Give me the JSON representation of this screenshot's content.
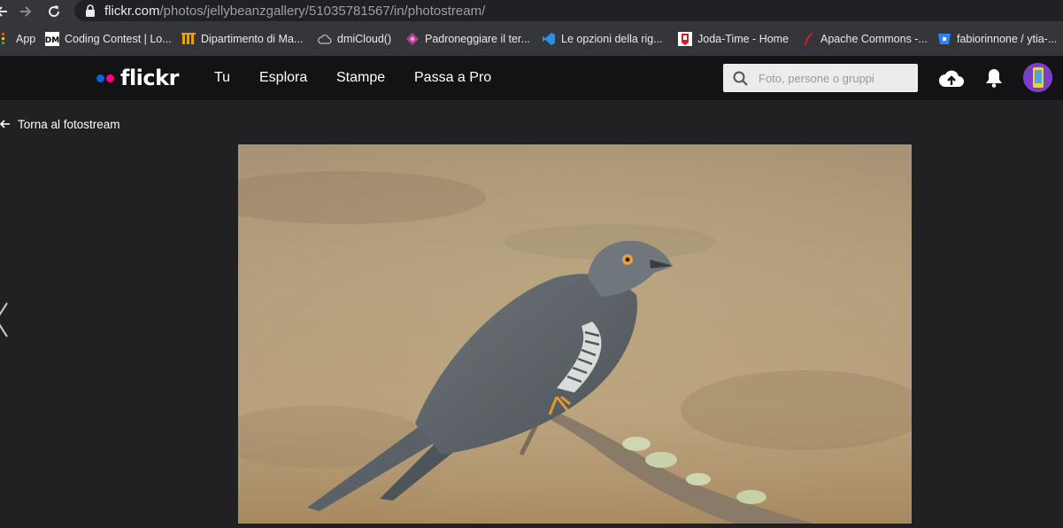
{
  "browser": {
    "url_host": "flickr.com",
    "url_path": "/photos/jellybeanzgallery/51035781567/in/photostream/",
    "bookmarks": [
      {
        "label": "App",
        "icon": "apps-grid-icon"
      },
      {
        "label": "Coding Contest | Lo...",
        "icon": "coding-contest-icon"
      },
      {
        "label": "Dipartimento di Ma...",
        "icon": "dipartimento-icon"
      },
      {
        "label": "dmiCloud()",
        "icon": "cloud-icon"
      },
      {
        "label": "Padroneggiare il ter...",
        "icon": "terminal-icon"
      },
      {
        "label": "Le opzioni della rig...",
        "icon": "vscode-icon"
      },
      {
        "label": "Joda-Time - Home",
        "icon": "joda-icon"
      },
      {
        "label": "Apache Commons -...",
        "icon": "apache-feather-icon"
      },
      {
        "label": "fabiorinnone / ytia-...",
        "icon": "bitbucket-icon"
      }
    ]
  },
  "header": {
    "logo_text": "flickr",
    "menu": [
      "Tu",
      "Esplora",
      "Stampe",
      "Passa a Pro"
    ],
    "search_placeholder": "Foto, persone o gruppi"
  },
  "page": {
    "back_label": "Torna al fotostream"
  },
  "colors": {
    "flickr_blue": "#0063dc",
    "flickr_pink": "#ff0084",
    "header_bg": "#131315",
    "page_bg": "#212124"
  }
}
